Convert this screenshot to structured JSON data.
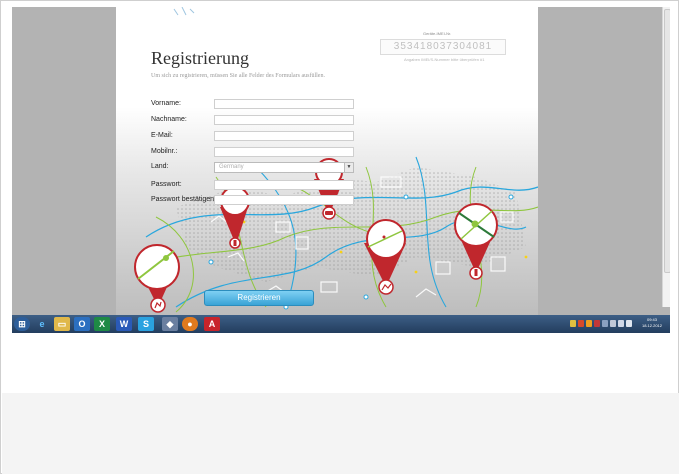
{
  "form": {
    "title": "Registrierung",
    "subtitle": "Um sich zu registrieren, müssen Sie alle Felder des Formulars ausfüllen.",
    "serial_label": "Geräte-IMEI-Nr.",
    "serial_value": "353418037304081",
    "serial_note": "Angaben IMEI/S-Nummer bitte überprüfen #1",
    "fields": [
      {
        "label": "Vorname:"
      },
      {
        "label": "Nachname:"
      },
      {
        "label": "E-Mail:"
      },
      {
        "label": "Mobilnr.:"
      },
      {
        "label": "Land:",
        "value": "Germany"
      },
      {
        "label": "Passwort:"
      },
      {
        "label": "Passwort bestätigen:"
      }
    ],
    "submit_label": "Registrieren"
  },
  "taskbar": {
    "clock_time": "09:43",
    "clock_date": "18.12.2012",
    "apps": [
      "start",
      "ie",
      "explorer",
      "outlook",
      "excel",
      "word",
      "skype",
      "app",
      "firefox",
      "acrobat"
    ]
  },
  "colors": {
    "accent_button": "#3aa3d6",
    "marker_red": "#c0272d",
    "road_green": "#8fc63f",
    "road_blue": "#2aa7dd",
    "taskbar": "#2c4a70"
  }
}
